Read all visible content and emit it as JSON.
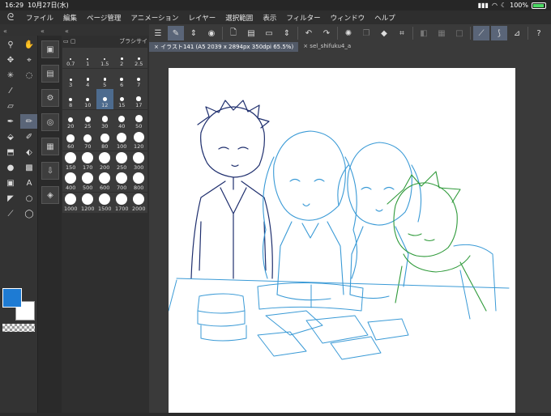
{
  "status": {
    "time": "16:29",
    "date": "10月27日(水)",
    "battery": "100%"
  },
  "menu": [
    "ファイル",
    "編集",
    "ページ管理",
    "アニメーション",
    "レイヤー",
    "選択範囲",
    "表示",
    "フィルター",
    "ウィンドウ",
    "ヘルプ"
  ],
  "brush_panel": {
    "title": "ブラシサイ"
  },
  "brush_sizes": [
    "0.7",
    "1",
    "1.5",
    "2",
    "2.5",
    "3",
    "4",
    "5",
    "6",
    "7",
    "8",
    "10",
    "12",
    "15",
    "17",
    "20",
    "25",
    "30",
    "40",
    "50",
    "60",
    "70",
    "80",
    "100",
    "120",
    "150",
    "170",
    "200",
    "250",
    "300",
    "400",
    "500",
    "600",
    "700",
    "800",
    "1000",
    "1200",
    "1500",
    "1700",
    "2000"
  ],
  "selected_size": "12",
  "tabs": [
    {
      "label": "イラスト141 (A5 2039 x 2894px 350dpi 65.5%)",
      "active": true
    },
    {
      "label": "sel_shifuku4_a",
      "active": false
    }
  ],
  "colors": {
    "main": "#1e7bd3",
    "sub": "#ffffff"
  },
  "sketch": {
    "colors": [
      "#1f2f6e",
      "#3a9ad6",
      "#2f9a3a"
    ]
  }
}
